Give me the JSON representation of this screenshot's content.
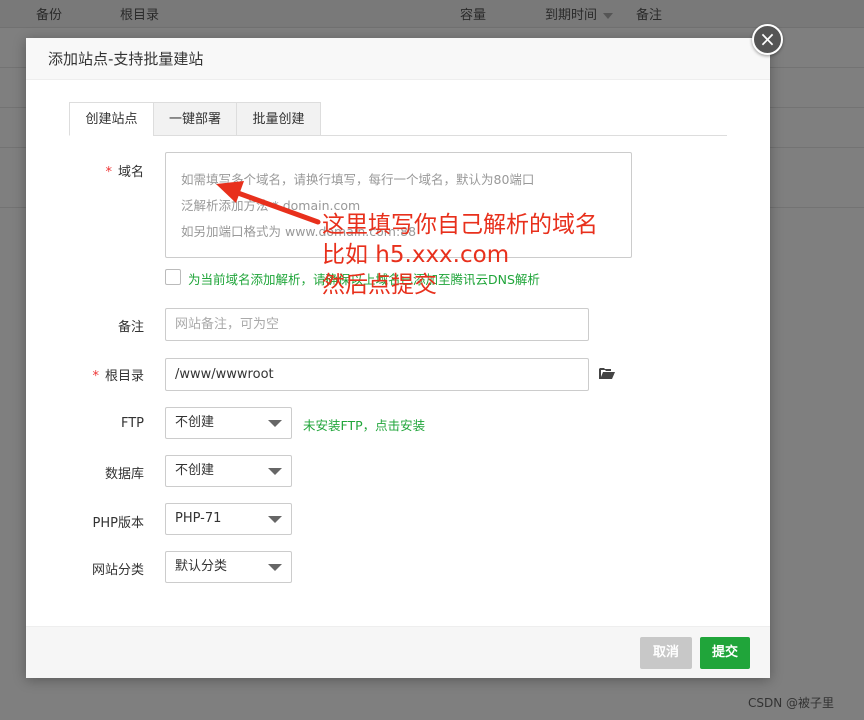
{
  "background_table": {
    "columns": [
      {
        "label": "备份"
      },
      {
        "label": "根目录"
      },
      {
        "label": "容量"
      },
      {
        "label": "到期时间"
      },
      {
        "label": "备注"
      }
    ]
  },
  "dialog": {
    "title": "添加站点-支持批量建站",
    "close_icon": "×",
    "tabs": [
      {
        "label": "创建站点",
        "active": true
      },
      {
        "label": "一键部署",
        "active": false
      },
      {
        "label": "批量创建",
        "active": false
      }
    ],
    "form": {
      "domain": {
        "required_mark": "*",
        "label": "域名",
        "placeholder_lines": [
          "如需填写多个域名，请换行填写，每行一个域名，默认为80端口",
          "泛解析添加方法 *.domain.com",
          "如另加端口格式为 www.domain.com:88"
        ]
      },
      "dns_checkbox": {
        "checked": false,
        "label": "为当前域名添加解析，请确保以上域名已添加至腾讯云DNS解析"
      },
      "remark": {
        "label": "备注",
        "placeholder": "网站备注，可为空"
      },
      "root": {
        "required_mark": "*",
        "label": "根目录",
        "value": "/www/wwwroot",
        "icon": "folder-open-icon"
      },
      "ftp": {
        "label": "FTP",
        "selected": "不创建",
        "hint": "未安装FTP，点击安装"
      },
      "database": {
        "label": "数据库",
        "selected": "不创建"
      },
      "php_version": {
        "label": "PHP版本",
        "selected": "PHP-71"
      },
      "site_category": {
        "label": "网站分类",
        "selected": "默认分类"
      }
    },
    "footer": {
      "cancel_label": "取消",
      "submit_label": "提交"
    }
  },
  "annotation": {
    "lines": [
      "这里填写你自己解析的域名",
      "比如 h5.xxx.com",
      "然后点提交"
    ],
    "color": "#e8301c"
  },
  "watermark": "CSDN @被子里",
  "colors": {
    "accent_green": "#20a53a",
    "required_red": "#e33333",
    "cancel_gray": "#c8c8c8"
  }
}
